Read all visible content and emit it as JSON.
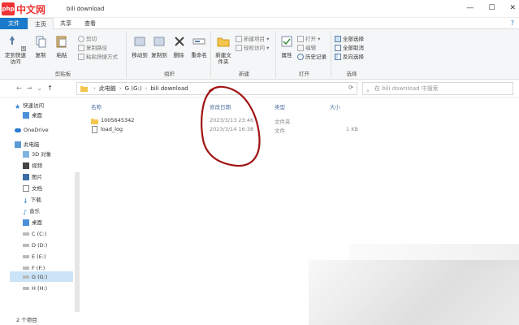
{
  "logo": {
    "badge": "php",
    "text": "中文网"
  },
  "window": {
    "title": "bili download",
    "min": "—",
    "max": "☐",
    "close": "✕"
  },
  "ribbon_tabs": {
    "file": "文件",
    "home": "主页",
    "share": "共享",
    "view": "查看",
    "help": "?"
  },
  "ribbon": {
    "clipboard": {
      "label": "剪贴板",
      "pin": "固定到快速访问",
      "copy": "复制",
      "paste": "粘贴",
      "copy_path": "复制路径",
      "paste_shortcut": "粘贴快捷方式",
      "cut": "剪切"
    },
    "organize": {
      "label": "组织",
      "move_to": "移动到",
      "copy_to": "复制到",
      "delete": "删除",
      "rename": "重命名"
    },
    "new": {
      "label": "新建",
      "new_folder": "新建文件夹",
      "new_item": "新建项目 ▾",
      "easy_access": "轻松访问 ▾"
    },
    "open": {
      "label": "打开",
      "properties": "属性",
      "open": "打开 ▾",
      "edit": "编辑",
      "history": "历史记录"
    },
    "select": {
      "label": "选择",
      "select_all": "全部选择",
      "select_none": "全部取消",
      "invert": "反向选择"
    }
  },
  "address": {
    "segments": [
      "此电脑",
      "G (G:)",
      "bili download"
    ],
    "search_placeholder": "在 bili download 中搜索"
  },
  "nav": {
    "items": [
      {
        "label": "快速访问",
        "icon": "star-icon"
      },
      {
        "label": "桌面",
        "icon": "desktop-icon"
      },
      {
        "label": "OneDrive",
        "icon": "cloud-icon"
      },
      {
        "label": "此电脑",
        "icon": "computer-icon"
      },
      {
        "label": "3D 对象",
        "icon": "cube-icon"
      },
      {
        "label": "视频",
        "icon": "video-icon"
      },
      {
        "label": "图片",
        "icon": "picture-icon"
      },
      {
        "label": "文档",
        "icon": "document-icon"
      },
      {
        "label": "下载",
        "icon": "download-icon"
      },
      {
        "label": "音乐",
        "icon": "music-icon"
      },
      {
        "label": "桌面",
        "icon": "desktop-icon"
      },
      {
        "label": "C (C:)",
        "icon": "drive-icon"
      },
      {
        "label": "D (D:)",
        "icon": "drive-icon"
      },
      {
        "label": "E (E:)",
        "icon": "drive-icon"
      },
      {
        "label": "F (F:)",
        "icon": "drive-icon"
      },
      {
        "label": "G (G:)",
        "icon": "drive-icon"
      },
      {
        "label": "H (H:)",
        "icon": "drive-icon"
      }
    ]
  },
  "columns": {
    "name": "名称",
    "date": "修改日期",
    "type": "类型",
    "size": "大小"
  },
  "files": [
    {
      "name": "1005645342",
      "date": "2023/3/13 23:46",
      "type": "文件夹",
      "size": "",
      "icon": "folder-icon"
    },
    {
      "name": "load_log",
      "date": "2023/3/14 16:38",
      "type": "文件",
      "size": "1 KB",
      "icon": "file-icon"
    }
  ],
  "status": {
    "count": "2 个项目"
  },
  "colors": {
    "accent": "#1979ca",
    "selection": "#cce4f7",
    "annotation": "#a11414"
  }
}
